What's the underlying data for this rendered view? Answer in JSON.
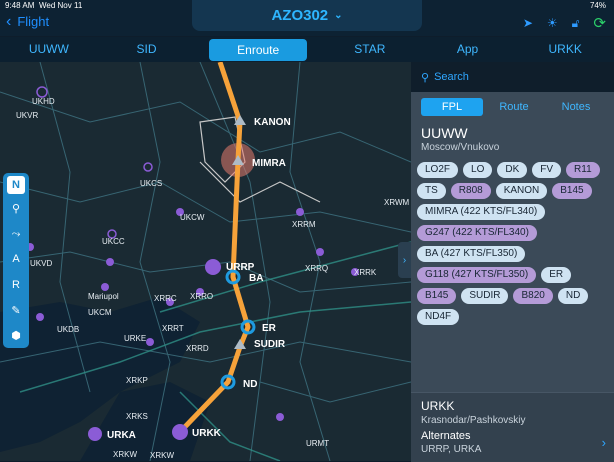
{
  "status": {
    "time": "9:48 AM",
    "date": "Wed Nov 11",
    "battery": "74%"
  },
  "header": {
    "back_label": "Flight",
    "title": "AZO302"
  },
  "tabs": [
    {
      "label": "UUWW"
    },
    {
      "label": "SID"
    },
    {
      "label": "Enroute",
      "active": true
    },
    {
      "label": "STAR"
    },
    {
      "label": "App"
    },
    {
      "label": "URKK"
    }
  ],
  "map": {
    "route_points": [
      {
        "name": "KANON"
      },
      {
        "name": "MIMRA"
      },
      {
        "name": "URRP"
      },
      {
        "name": "BA"
      },
      {
        "name": "ER"
      },
      {
        "name": "SUDIR"
      },
      {
        "name": "ND"
      },
      {
        "name": "URKK"
      },
      {
        "name": "URKA"
      }
    ],
    "labels": [
      "UKHD",
      "UKVR",
      "UKCS",
      "UKCW",
      "UKCC",
      "UKVD",
      "UKCM",
      "UKDB",
      "XRRM",
      "XRWM",
      "XRRQ",
      "XRRK",
      "XRRC",
      "XRRO",
      "XRRT",
      "URKE",
      "XRRD",
      "XRKP",
      "XRKS",
      "URMT",
      "XRKW",
      "XRKW",
      "Mariupol"
    ],
    "toolbar": [
      "N",
      "location",
      "route",
      "A",
      "R",
      "fuel",
      "settings"
    ]
  },
  "panel": {
    "search_placeholder": "Search",
    "segments": [
      {
        "label": "FPL",
        "active": true
      },
      {
        "label": "Route"
      },
      {
        "label": "Notes"
      }
    ],
    "origin": {
      "code": "UUWW",
      "name": "Moscow/Vnukovo"
    },
    "chips": [
      {
        "label": "LO2F",
        "purple": false
      },
      {
        "label": "LO",
        "purple": false
      },
      {
        "label": "DK",
        "purple": false
      },
      {
        "label": "FV",
        "purple": false
      },
      {
        "label": "R11",
        "purple": true
      },
      {
        "label": "TS",
        "purple": false
      },
      {
        "label": "R808",
        "purple": true
      },
      {
        "label": "KANON",
        "purple": false
      },
      {
        "label": "B145",
        "purple": true
      },
      {
        "label": "MIMRA (422 KTS/FL340)",
        "purple": false
      },
      {
        "label": "G247 (422 KTS/FL340)",
        "purple": true
      },
      {
        "label": "BA (427 KTS/FL350)",
        "purple": false
      },
      {
        "label": "G118 (427 KTS/FL350)",
        "purple": true
      },
      {
        "label": "ER",
        "purple": false
      },
      {
        "label": "B145",
        "purple": true
      },
      {
        "label": "SUDIR",
        "purple": false
      },
      {
        "label": "B820",
        "purple": true
      },
      {
        "label": "ND",
        "purple": false
      },
      {
        "label": "ND4F",
        "purple": false
      }
    ],
    "destination": {
      "code": "URKK",
      "name": "Krasnodar/Pashkovskiy"
    },
    "alternates": {
      "title": "Alternates",
      "list": "URRP, URKA"
    }
  }
}
